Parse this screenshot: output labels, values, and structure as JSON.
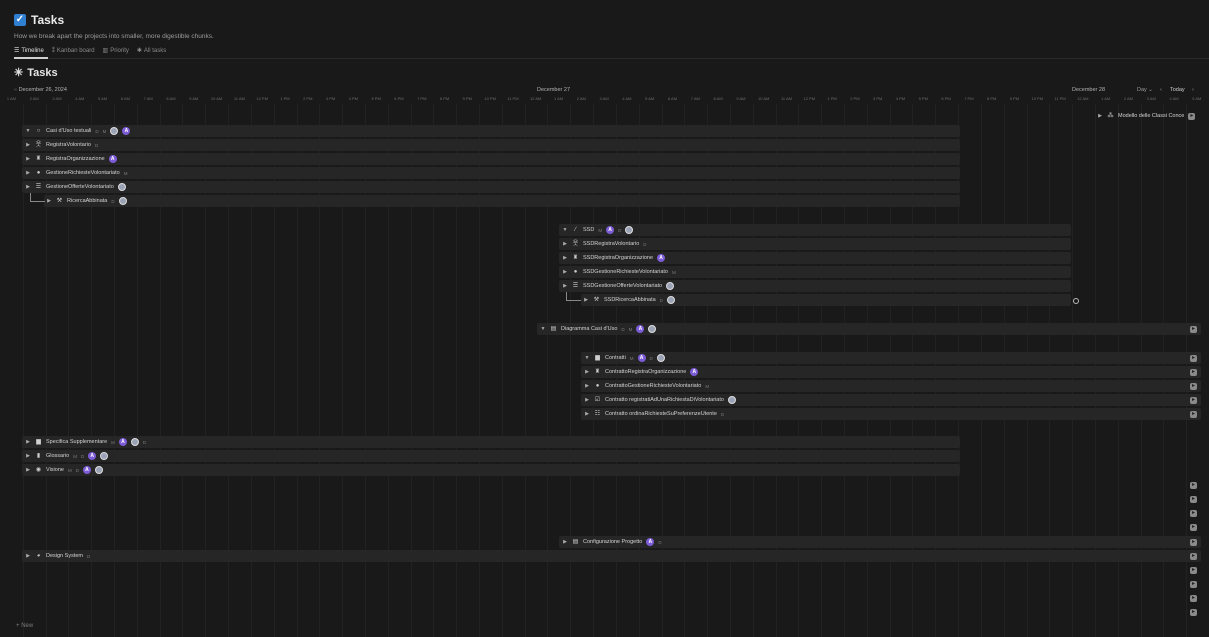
{
  "page": {
    "title": "Tasks",
    "description": "How we break apart the projects into smaller, more digestible chunks."
  },
  "tabs": [
    {
      "label": "Timeline",
      "icon": "timeline-icon"
    },
    {
      "label": "Kanban board",
      "icon": "kanban-icon"
    },
    {
      "label": "Priority",
      "icon": "table-icon"
    },
    {
      "label": "All tasks",
      "icon": "asterisk-icon"
    }
  ],
  "view": {
    "title": "Tasks"
  },
  "timeline": {
    "dates": [
      "December 26, 2024",
      "December 27",
      "December 28"
    ],
    "day_label": "Day",
    "today_label": "Today",
    "hours": [
      "1 AM",
      "2 AM",
      "3 AM",
      "4 AM",
      "5 AM",
      "6 AM",
      "7 AM",
      "8 AM",
      "9 AM",
      "10 AM",
      "11 AM",
      "12 PM",
      "1 PM",
      "2 PM",
      "3 PM",
      "4 PM",
      "5 PM",
      "6 PM",
      "7 PM",
      "8 PM",
      "9 PM",
      "10 PM",
      "11 PM",
      "12 AM",
      "1 AM",
      "2 AM",
      "3 AM",
      "4 AM",
      "5 AM",
      "6 AM",
      "7 AM",
      "8 AM",
      "9 AM",
      "10 AM",
      "11 AM",
      "12 PM",
      "1 PM",
      "2 PM",
      "3 PM",
      "4 PM",
      "5 PM",
      "6 PM",
      "7 PM",
      "8 PM",
      "9 PM",
      "10 PM",
      "11 PM",
      "12 AM",
      "1 AM",
      "2 AM",
      "3 AM",
      "4 AM",
      "5 AM"
    ]
  },
  "tasks": {
    "modello": "Modello delle Classi Conce",
    "casi_duso": "Casi d'Uso testuali",
    "registra_volontario": "RegistraVolontario",
    "registra_organizzazione": "RegistraOrganizzazione",
    "gestione_richieste": "GestioneRichiesteVolontariato",
    "gestione_offerte": "GestioneOfferteVolontariato",
    "ricerca_abbinata": "RicercaAbbinata",
    "ssd": "SSD",
    "ssd_registra_volontario": "SSDRegistraVolontario",
    "ssd_registra_organizzazione": "SSDRegistraOrganizzazione",
    "ssd_gestione_richieste": "SSDGestioneRichiesteVolontariato",
    "ssd_gestione_offerte": "SSDGestioneOfferteVolontariato",
    "ssd_ricerca_abbinata": "SSDRicercaAbbinata",
    "diagramma": "Diagramma Casi d'Uso",
    "contratti": "Contratti",
    "contratto_registra_org": "ContrattoRegistraOrganizzazione",
    "contratto_gestione_richieste": "ContrattoGestioneRichiesteVolontariato",
    "contratto_registrati": "Contratto registratiAdUnaRichiestaDiVolontariato",
    "contratto_ordina": "Contratto ordinaRichiesteSuPreferenzeUtente",
    "specifica": "Specifica Supplementare",
    "glossario": "Glossario",
    "visione": "Visione",
    "configurazione": "Configurazione Progetto",
    "design_system": "Design System"
  },
  "tags": {
    "d": "D",
    "m": "M"
  },
  "avatar_letter": "A",
  "new_label": "New",
  "colors": {
    "accent": "#7c5cd6",
    "check": "#2f80d1",
    "background": "#191919"
  }
}
